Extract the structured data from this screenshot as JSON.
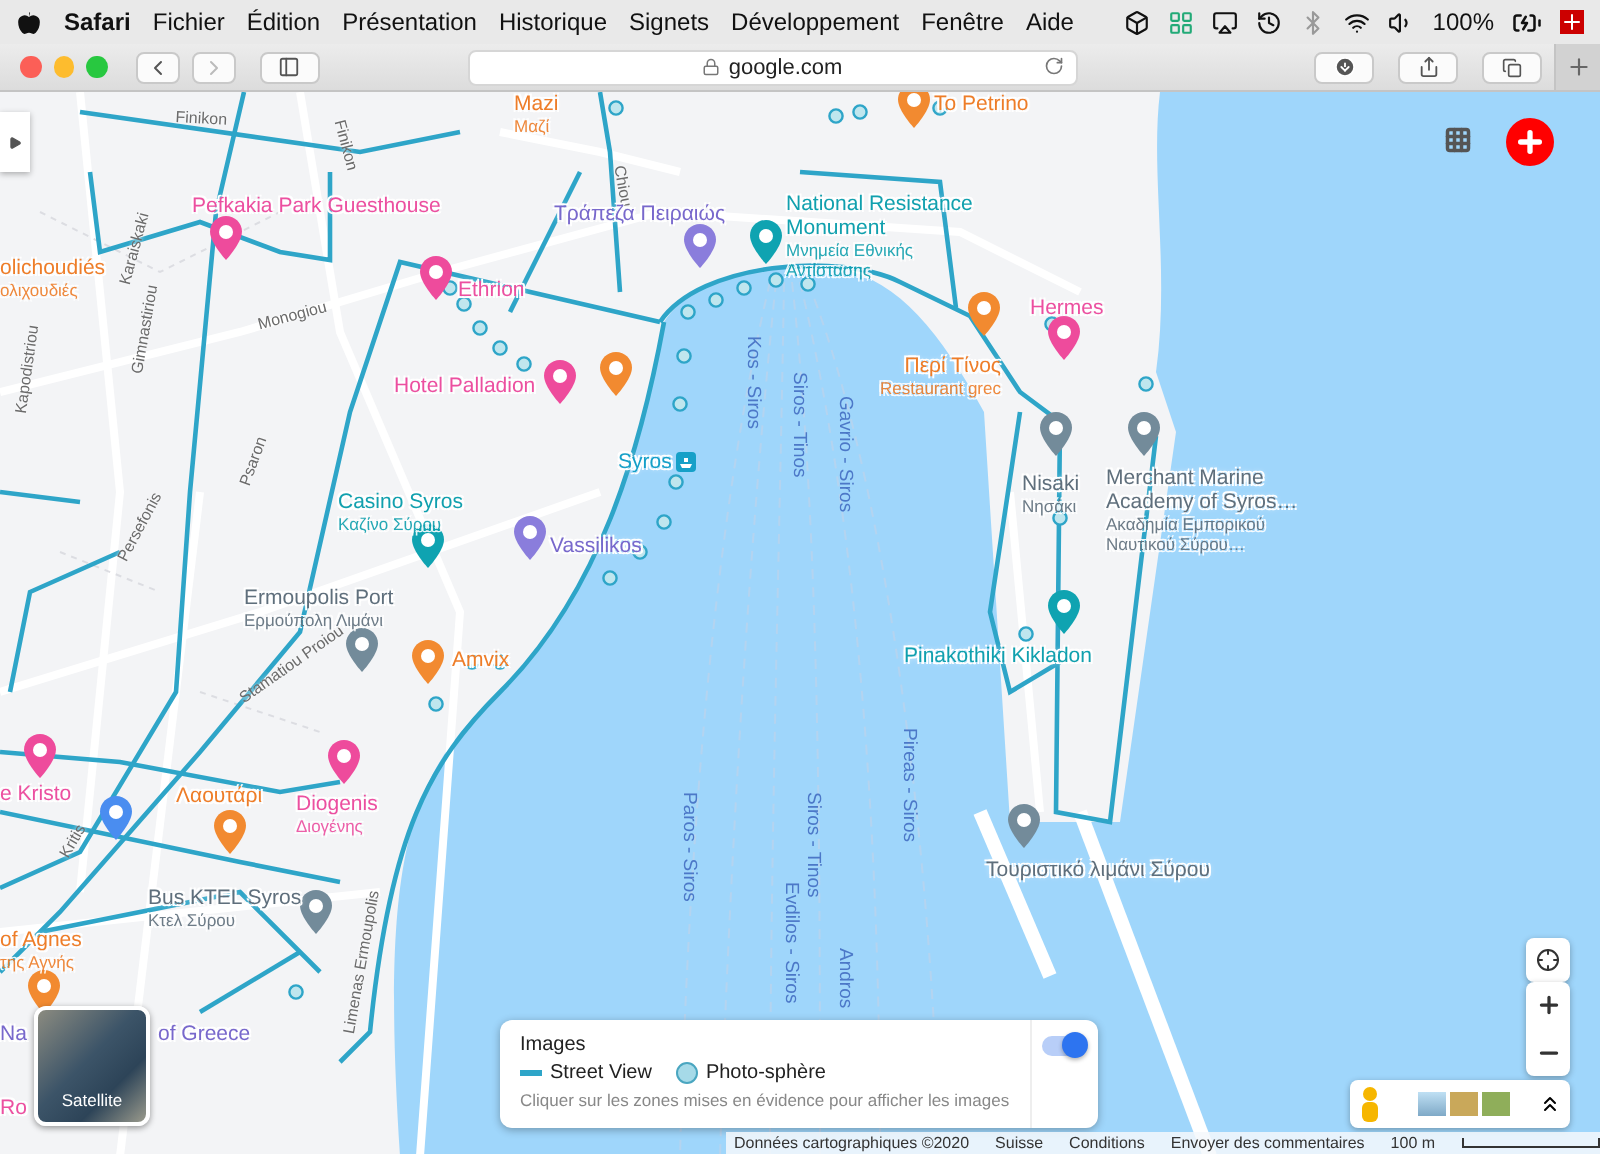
{
  "menu_bar": {
    "app": "Safari",
    "items": [
      "Fichier",
      "Édition",
      "Présentation",
      "Historique",
      "Signets",
      "Développement",
      "Fenêtre",
      "Aide"
    ],
    "battery": "100%"
  },
  "toolbar": {
    "url": "google.com"
  },
  "places": [
    {
      "kind": "restaurant",
      "name": "Mazi",
      "subname": "Μαζί"
    },
    {
      "kind": "restaurant",
      "name": "To Petrino"
    },
    {
      "kind": "hotel",
      "name": "Pefkakia Park Guesthouse"
    },
    {
      "kind": "restaurant",
      "name": "olichoudiés",
      "subname": "ολιχουδιές"
    },
    {
      "kind": "bank",
      "name": "Τράπεζα Πειραιώς"
    },
    {
      "kind": "landmark",
      "name": "National Resistance Monument",
      "subname": "Μνημεία Εθνικής Αντίστασης"
    },
    {
      "kind": "hotel",
      "name": "Ethrion"
    },
    {
      "kind": "hotel",
      "name": "Hotel Palladion"
    },
    {
      "kind": "hotel",
      "name": "Hermes"
    },
    {
      "kind": "restaurant",
      "name": "Περί Τίνος",
      "subname": "Restaurant grec"
    },
    {
      "kind": "transit",
      "name": "Syros"
    },
    {
      "kind": "landmark",
      "name": "Casino Syros",
      "subname": "Καζίνο Σύρου"
    },
    {
      "kind": "bank",
      "name": "Vassilikos"
    },
    {
      "kind": "place",
      "name": "Nisaki",
      "subname": "Νησάκι"
    },
    {
      "kind": "place",
      "name": "Merchant Marine Academy of Syros…",
      "subname": "Ακαδημία Εμπορικού Ναυτικού Σύρου…"
    },
    {
      "kind": "place",
      "name": "Ermoupolis Port",
      "subname": "Ερμούπολη Λιμάνι"
    },
    {
      "kind": "restaurant",
      "name": "Amvix"
    },
    {
      "kind": "landmark",
      "name": "Pinakothiki Kikladon"
    },
    {
      "kind": "hotel",
      "name": "e Kristo"
    },
    {
      "kind": "restaurant",
      "name": "Λαουτάρι"
    },
    {
      "kind": "hotel",
      "name": "Diogenis",
      "subname": "Διογένης"
    },
    {
      "kind": "place",
      "name": "Bus KTEL Syros",
      "subname": "Κτελ Σύρου"
    },
    {
      "kind": "restaurant",
      "name": "of Agnes",
      "subname": "της Αγνής"
    },
    {
      "kind": "bank",
      "name": "Na"
    },
    {
      "kind": "bank",
      "name": "of Greece"
    },
    {
      "kind": "hotel",
      "name": "Ro"
    },
    {
      "kind": "place",
      "name": "Τουριστικό λιμάνι Σύρου"
    }
  ],
  "streets": [
    "Finikon",
    "Finikon",
    "Karaiskaki",
    "Kapodistriou",
    "Monogiou",
    "Gimnastiriou",
    "Chiou",
    "Psaron",
    "Persefonis",
    "Stamatiou Proiou",
    "Kritis",
    "Limenas Ermoupolis"
  ],
  "ferry_routes": [
    "Kos - Siros",
    "Siros - Tinos",
    "Gavrio - Siros",
    "Paros - Siros",
    "Siros - Tinos",
    "Pireas - Siros",
    "Evdilos - Siros",
    "Andros"
  ],
  "satellite": {
    "label": "Satellite"
  },
  "legend": {
    "title": "Images",
    "on": true,
    "items": [
      {
        "kind": "line",
        "label": "Street View"
      },
      {
        "kind": "dot",
        "label": "Photo-sphère"
      }
    ],
    "hint": "Cliquer sur les zones mises en évidence pour afficher les images"
  },
  "footer": {
    "items": [
      "Données cartographiques ©2020",
      "Suisse",
      "Conditions",
      "Envoyer des commentaires"
    ],
    "scale": "100 m"
  }
}
